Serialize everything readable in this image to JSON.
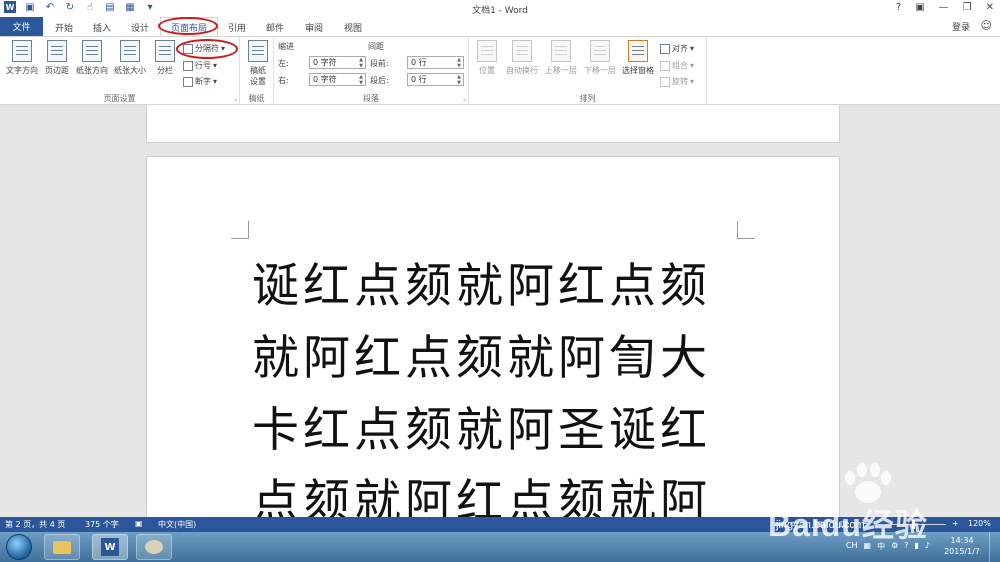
{
  "window": {
    "title": "文档1 - Word",
    "controls": [
      "?",
      "▣",
      "—",
      "❐",
      "✕"
    ]
  },
  "quick_access": {
    "icons": [
      "word-logo",
      "save-icon",
      "undo-icon",
      "redo-icon",
      "touch-mode-icon",
      "print-icon",
      "table-icon",
      "more-icon"
    ]
  },
  "tabs": {
    "file": "文件",
    "items": [
      "开始",
      "插入",
      "设计",
      "页面布局",
      "引用",
      "邮件",
      "审阅",
      "视图"
    ],
    "active": "页面布局"
  },
  "account": {
    "login": "登录"
  },
  "ribbon": {
    "page_setup": {
      "label": "页面设置",
      "text_direction": "文字方向",
      "margins": "页边距",
      "orientation": "纸张方向",
      "size": "纸张大小",
      "columns": "分栏",
      "breaks": "分隔符",
      "line_numbers": "行号",
      "hyphenation": "断字"
    },
    "manuscript": {
      "label": "稿纸",
      "setup_line1": "稿纸",
      "setup_line2": "设置"
    },
    "paragraph": {
      "label": "段落",
      "indent_header": "缩进",
      "spacing_header": "间距",
      "left_label": "左:",
      "left_value": "0 字符",
      "right_label": "右:",
      "right_value": "0 字符",
      "before_label": "段前:",
      "before_value": "0 行",
      "after_label": "段后:",
      "after_value": "0 行"
    },
    "arrange": {
      "label": "排列",
      "position": "位置",
      "wrap_text": "自动换行",
      "bring_forward": "上移一层",
      "send_backward": "下移一层",
      "selection_pane": "选择窗格",
      "align": "对齐",
      "group": "组合",
      "rotate": "旋转"
    }
  },
  "document": {
    "lines": [
      "诞红点颏就阿红点颏",
      "就阿红点颏就阿訇大",
      "卡红点颏就阿圣诞红",
      "点颏就阿红点颏就阿"
    ]
  },
  "status_bar": {
    "page": "第 2 页，共 4 页",
    "words": "375 个字",
    "language": "中文(中国)",
    "zoom": "120%"
  },
  "taskbar": {
    "tray_lang": "CH",
    "ime": "中",
    "time": "14:34",
    "date": "2015/1/7"
  },
  "watermark": {
    "brand": "Baidu经验",
    "url": "jingyan.baidu.com"
  },
  "colors": {
    "accent": "#2b579a",
    "highlight_ring": "#d01818"
  }
}
